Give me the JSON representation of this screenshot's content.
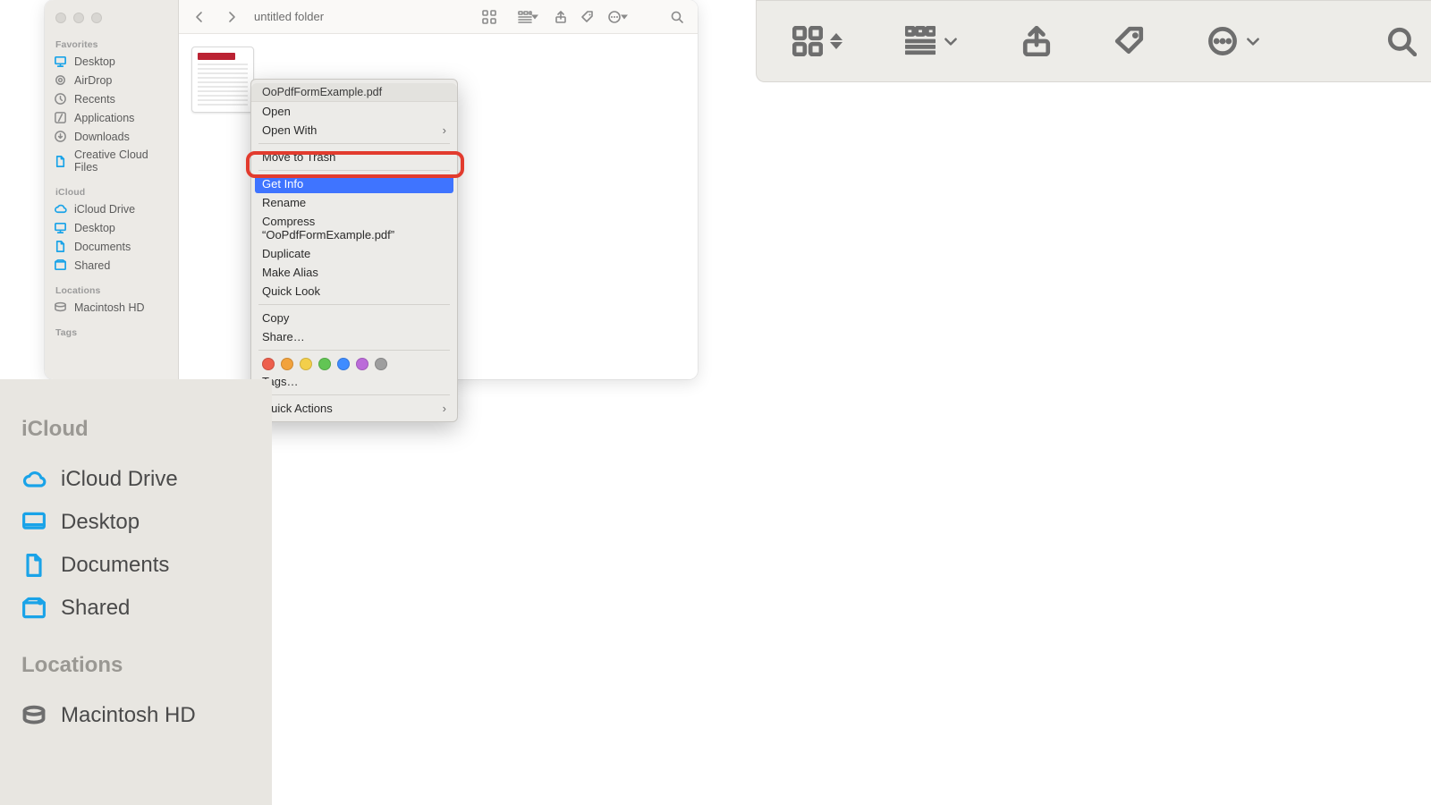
{
  "window": {
    "title": "untitled folder",
    "selected_file": "OoPdfFormExample.pdf"
  },
  "sidebar": {
    "sections": [
      {
        "title": "Favorites",
        "items": [
          {
            "label": "Desktop",
            "icon": "desktop"
          },
          {
            "label": "AirDrop",
            "icon": "airdrop"
          },
          {
            "label": "Recents",
            "icon": "clock"
          },
          {
            "label": "Applications",
            "icon": "app"
          },
          {
            "label": "Downloads",
            "icon": "download"
          },
          {
            "label": "Creative Cloud Files",
            "icon": "file"
          }
        ]
      },
      {
        "title": "iCloud",
        "items": [
          {
            "label": "iCloud Drive",
            "icon": "cloud"
          },
          {
            "label": "Desktop",
            "icon": "desktop"
          },
          {
            "label": "Documents",
            "icon": "file"
          },
          {
            "label": "Shared",
            "icon": "shared"
          }
        ]
      },
      {
        "title": "Locations",
        "items": [
          {
            "label": "Macintosh HD",
            "icon": "disk"
          }
        ]
      },
      {
        "title": "Tags",
        "items": []
      }
    ]
  },
  "context_menu": {
    "header": "OoPdfFormExample.pdf",
    "items": [
      {
        "label": "Open"
      },
      {
        "label": "Open With",
        "submenu": true
      },
      {
        "sep": true
      },
      {
        "label": "Move to Trash"
      },
      {
        "sep": true
      },
      {
        "label": "Get Info",
        "selected": true
      },
      {
        "label": "Rename"
      },
      {
        "label": "Compress “OoPdfFormExample.pdf”"
      },
      {
        "label": "Duplicate"
      },
      {
        "label": "Make Alias"
      },
      {
        "label": "Quick Look"
      },
      {
        "sep": true
      },
      {
        "label": "Copy"
      },
      {
        "label": "Share…"
      },
      {
        "sep": true
      },
      {
        "tags": [
          "#ed5f4d",
          "#f2a23c",
          "#f3cf4a",
          "#62c554",
          "#3f8cff",
          "#bb6bd9",
          "#9e9e9e"
        ]
      },
      {
        "label": "Tags…"
      },
      {
        "sep": true
      },
      {
        "label": "Quick Actions",
        "submenu": true
      }
    ]
  },
  "big_sidebar": {
    "sections": [
      {
        "title": "iCloud",
        "items": [
          {
            "label": "iCloud Drive",
            "icon": "cloud"
          },
          {
            "label": "Desktop",
            "icon": "desktop"
          },
          {
            "label": "Documents",
            "icon": "file"
          },
          {
            "label": "Shared",
            "icon": "shared"
          }
        ]
      },
      {
        "title": "Locations",
        "items": [
          {
            "label": "Macintosh HD",
            "icon": "disk"
          }
        ]
      }
    ]
  }
}
